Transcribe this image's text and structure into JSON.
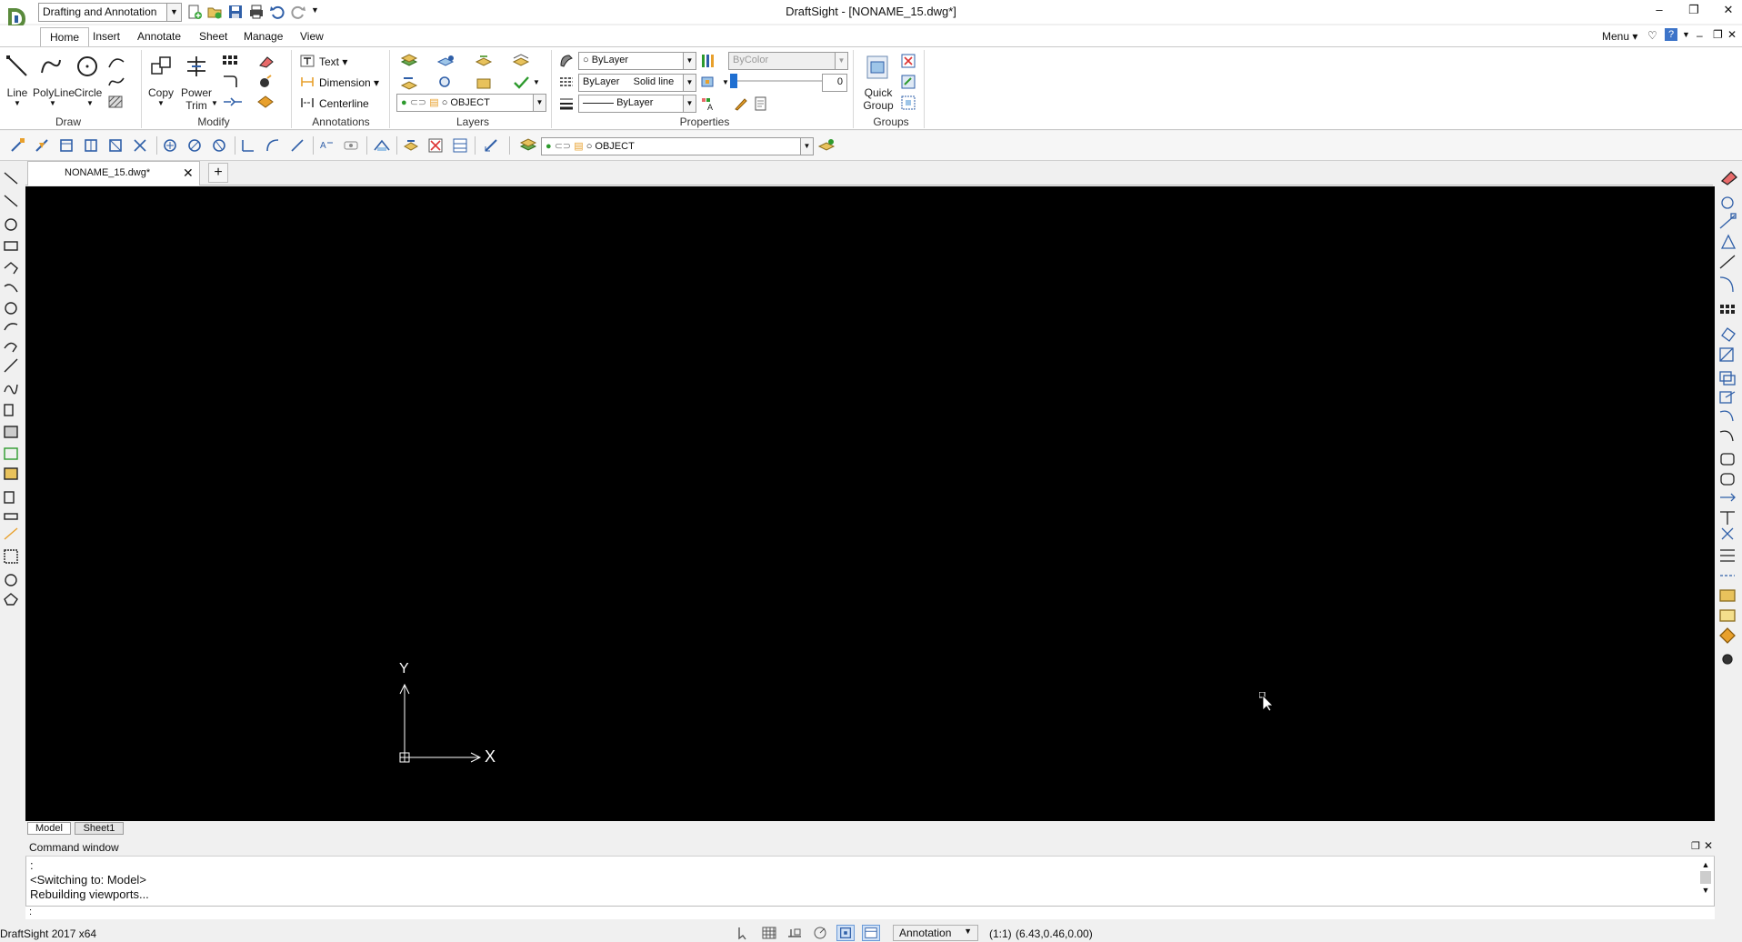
{
  "app": {
    "window_title": "DraftSight - [NONAME_15.dwg*]",
    "workspace": "Drafting and Annotation",
    "menu_label": "Menu"
  },
  "ribbon": {
    "tabs": [
      "Home",
      "Insert",
      "Annotate",
      "Sheet",
      "Manage",
      "View"
    ],
    "active_tab": "Home",
    "groups": {
      "draw": {
        "label": "Draw",
        "line": "Line",
        "polyline": "PolyLine",
        "circle": "Circle"
      },
      "modify": {
        "label": "Modify",
        "copy": "Copy",
        "power_trim_1": "Power",
        "power_trim_2": "Trim"
      },
      "annotations": {
        "label": "Annotations",
        "text": "Text",
        "dimension": "Dimension",
        "centerline": "Centerline"
      },
      "layers": {
        "label": "Layers",
        "layer_combo": "OBJECT"
      },
      "properties": {
        "label": "Properties",
        "color": "ByLayer",
        "linestyle_layer": "ByLayer",
        "linestyle": "Solid line",
        "lineweight": "ByLayer",
        "bycolor": "ByColor",
        "transparency": "0"
      },
      "groups": {
        "label": "Groups",
        "quick_group_1": "Quick",
        "quick_group_2": "Group"
      }
    }
  },
  "toolbar": {
    "layer_combo": "OBJECT"
  },
  "document": {
    "tab_name": "NONAME_15.dwg*",
    "new_tab": "+"
  },
  "canvas": {
    "ucs_y": "Y",
    "ucs_x": "X"
  },
  "model_tabs": [
    "Model",
    "Sheet1"
  ],
  "command_window": {
    "title": "Command window",
    "lines": [
      ":",
      "<Switching to: Model>",
      "Rebuilding viewports..."
    ],
    "prompt": ":"
  },
  "status": {
    "product": "DraftSight 2017 x64",
    "annotation": "Annotation",
    "scale": "(1:1)",
    "coords": "(6.43,0.46,0.00)"
  },
  "colors": {
    "canvas_bg": "#000000",
    "ribbon_bg": "#ffffff",
    "accent": "#1f6fd1"
  }
}
